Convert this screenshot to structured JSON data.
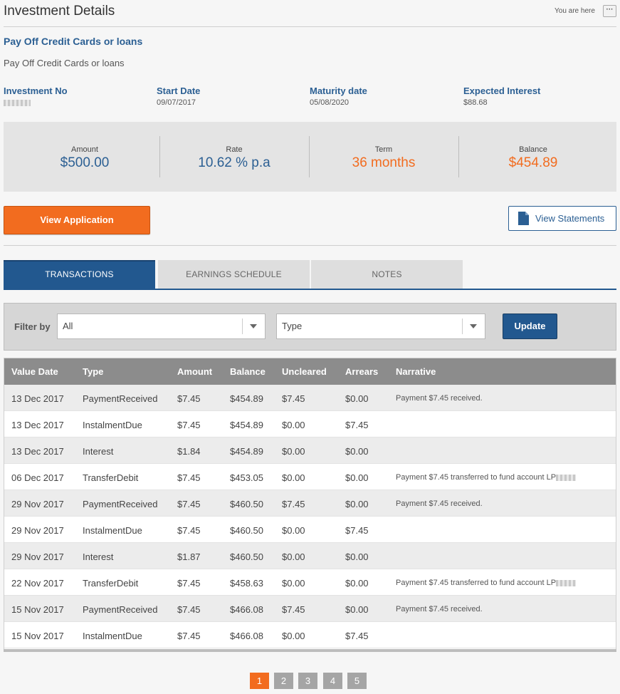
{
  "header": {
    "title": "Investment Details",
    "you_are_here": "You are here",
    "more_label": "···"
  },
  "investment": {
    "title": "Pay Off Credit Cards or loans",
    "subtitle": "Pay Off Credit Cards or loans",
    "meta": [
      {
        "label": "Investment No",
        "value": ""
      },
      {
        "label": "Start Date",
        "value": "09/07/2017"
      },
      {
        "label": "Maturity date",
        "value": "05/08/2020"
      },
      {
        "label": "Expected Interest",
        "value": "$88.68"
      }
    ]
  },
  "summary": [
    {
      "label": "Amount",
      "value": "$500.00"
    },
    {
      "label": "Rate",
      "value": "10.62 % p.a"
    },
    {
      "label": "Term",
      "value": "36 months"
    },
    {
      "label": "Balance",
      "value": "$454.89"
    }
  ],
  "actions": {
    "view_application": "View Application",
    "view_statements": "View Statements"
  },
  "tabs": [
    {
      "label": "TRANSACTIONS",
      "active": true
    },
    {
      "label": "EARNINGS SCHEDULE",
      "active": false
    },
    {
      "label": "NOTES",
      "active": false
    }
  ],
  "filter": {
    "label": "Filter by",
    "select1_value": "All",
    "select2_value": "Type",
    "update_label": "Update"
  },
  "table": {
    "columns": [
      "Value Date",
      "Type",
      "Amount",
      "Balance",
      "Uncleared",
      "Arrears",
      "Narrative"
    ],
    "rows": [
      [
        "13 Dec 2017",
        "PaymentReceived",
        "$7.45",
        "$454.89",
        "$7.45",
        "$0.00",
        "Payment $7.45 received."
      ],
      [
        "13 Dec 2017",
        "InstalmentDue",
        "$7.45",
        "$454.89",
        "$0.00",
        "$7.45",
        ""
      ],
      [
        "13 Dec 2017",
        "Interest",
        "$1.84",
        "$454.89",
        "$0.00",
        "$0.00",
        ""
      ],
      [
        "06 Dec 2017",
        "TransferDebit",
        "$7.45",
        "$453.05",
        "$0.00",
        "$0.00",
        "Payment $7.45 transferred to fund account LP"
      ],
      [
        "29 Nov 2017",
        "PaymentReceived",
        "$7.45",
        "$460.50",
        "$7.45",
        "$0.00",
        "Payment $7.45 received."
      ],
      [
        "29 Nov 2017",
        "InstalmentDue",
        "$7.45",
        "$460.50",
        "$0.00",
        "$7.45",
        ""
      ],
      [
        "29 Nov 2017",
        "Interest",
        "$1.87",
        "$460.50",
        "$0.00",
        "$0.00",
        ""
      ],
      [
        "22 Nov 2017",
        "TransferDebit",
        "$7.45",
        "$458.63",
        "$0.00",
        "$0.00",
        "Payment $7.45 transferred to fund account LP"
      ],
      [
        "15 Nov 2017",
        "PaymentReceived",
        "$7.45",
        "$466.08",
        "$7.45",
        "$0.00",
        "Payment $7.45 received."
      ],
      [
        "15 Nov 2017",
        "InstalmentDue",
        "$7.45",
        "$466.08",
        "$0.00",
        "$7.45",
        ""
      ]
    ]
  },
  "pagination": {
    "pages": [
      "1",
      "2",
      "3",
      "4",
      "5"
    ],
    "current": "1"
  },
  "colors": {
    "accent_blue": "#22588f",
    "accent_orange": "#f26c1f",
    "link_blue": "#2b5f93"
  }
}
